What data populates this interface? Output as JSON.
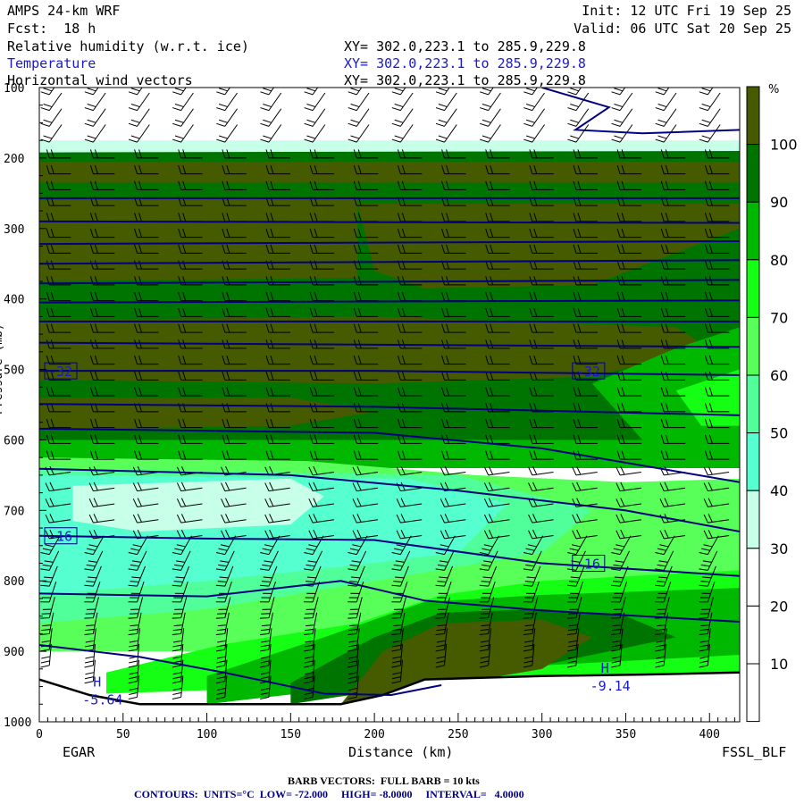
{
  "header": {
    "model": "AMPS 24-km WRF",
    "fcst": "Fcst:  18 h",
    "init": "Init: 12 UTC Fri 19 Sep 25",
    "valid": "Valid: 06 UTC Sat 20 Sep 25",
    "fields": [
      {
        "name": "Relative humidity (w.r.t. ice)",
        "xy": "XY= 302.0,223.1 to 285.9,229.8"
      },
      {
        "name": "Temperature",
        "xy": "XY= 302.0,223.1 to 285.9,229.8"
      },
      {
        "name": "Horizontal wind vectors",
        "xy": "XY= 302.0,223.1 to 285.9,229.8"
      }
    ]
  },
  "footer": {
    "start_station": "EGAR",
    "end_station": "FSSL_BLF",
    "barb_note": "BARB VECTORS:  FULL BARB = 10 kts",
    "contour_note": "CONTOURS:  UNITS=°C  LOW= -72.000     HIGH= -8.0000     INTERVAL=   4.0000"
  },
  "chart_data": {
    "type": "heatmap",
    "title": "Relative humidity (w.r.t. ice), Temperature, Horizontal wind vectors",
    "xlabel": "Distance (km)",
    "ylabel": "Pressure (mb)",
    "xlim": [
      0,
      418
    ],
    "ylim": [
      1000,
      100
    ],
    "xticks": [
      "0",
      "50",
      "100",
      "150",
      "200",
      "250",
      "300",
      "350",
      "400"
    ],
    "yticks": [
      "100",
      "200",
      "300",
      "400",
      "500",
      "600",
      "700",
      "800",
      "900",
      "1000"
    ],
    "colorbar": {
      "unit": "%",
      "labels": [
        "100",
        "90",
        "80",
        "70",
        "60",
        "50",
        "40",
        "30",
        "20",
        "10"
      ],
      "levels": [
        0,
        10,
        20,
        30,
        40,
        50,
        60,
        70,
        80,
        90,
        100
      ],
      "colors": [
        "#ffffff",
        "#ffffff",
        "#ffffff",
        "#c8ffe8",
        "#55ffd0",
        "#50ff9a",
        "#58ff58",
        "#14ff14",
        "#00b800",
        "#007400",
        "#465a00"
      ]
    },
    "rh_regions": [
      {
        "rh": ">100",
        "color": "#465a00",
        "poly": [
          [
            0,
            205
          ],
          [
            418,
            205
          ],
          [
            418,
            235
          ],
          [
            0,
            235
          ]
        ]
      },
      {
        "rh": ">100",
        "color": "#465a00",
        "poly": [
          [
            0,
            260
          ],
          [
            190,
            255
          ],
          [
            190,
            370
          ],
          [
            0,
            375
          ]
        ]
      },
      {
        "rh": ">100",
        "color": "#465a00",
        "poly": [
          [
            190,
            265
          ],
          [
            418,
            265
          ],
          [
            418,
            300
          ],
          [
            330,
            380
          ],
          [
            230,
            385
          ],
          [
            200,
            360
          ]
        ]
      },
      {
        "rh": ">100",
        "color": "#465a00",
        "poly": [
          [
            0,
            430
          ],
          [
            200,
            425
          ],
          [
            380,
            440
          ],
          [
            400,
            470
          ],
          [
            330,
            510
          ],
          [
            200,
            520
          ],
          [
            0,
            515
          ]
        ]
      },
      {
        "rh": ">100",
        "color": "#465a00",
        "poly": [
          [
            0,
            540
          ],
          [
            150,
            540
          ],
          [
            200,
            560
          ],
          [
            150,
            580
          ],
          [
            0,
            585
          ]
        ]
      },
      {
        "rh": "80-90",
        "color": "#00b800",
        "poly": [
          [
            330,
            520
          ],
          [
            380,
            470
          ],
          [
            418,
            440
          ],
          [
            418,
            600
          ],
          [
            360,
            600
          ]
        ]
      },
      {
        "rh": "70-80",
        "color": "#14ff14",
        "poly": [
          [
            380,
            530
          ],
          [
            418,
            500
          ],
          [
            418,
            580
          ],
          [
            395,
            580
          ]
        ]
      },
      {
        "rh": "80-90",
        "color": "#00b800",
        "poly": [
          [
            0,
            600
          ],
          [
            418,
            600
          ],
          [
            418,
            640
          ],
          [
            0,
            640
          ]
        ]
      },
      {
        "rh": "60-70",
        "color": "#58ff58",
        "poly": [
          [
            0,
            625
          ],
          [
            160,
            630
          ],
          [
            260,
            650
          ],
          [
            350,
            660
          ],
          [
            418,
            655
          ],
          [
            418,
            900
          ],
          [
            0,
            900
          ]
        ]
      },
      {
        "rh": "50-60",
        "color": "#50ff9a",
        "poly": [
          [
            0,
            640
          ],
          [
            250,
            650
          ],
          [
            330,
            700
          ],
          [
            300,
            760
          ],
          [
            200,
            800
          ],
          [
            100,
            840
          ],
          [
            0,
            860
          ]
        ]
      },
      {
        "rh": "40-50",
        "color": "#55ffd0",
        "poly": [
          [
            0,
            650
          ],
          [
            220,
            655
          ],
          [
            280,
            690
          ],
          [
            250,
            760
          ],
          [
            180,
            780
          ],
          [
            100,
            800
          ],
          [
            0,
            820
          ]
        ]
      },
      {
        "rh": "30-40",
        "color": "#c8ffe8",
        "poly": [
          [
            20,
            665
          ],
          [
            150,
            655
          ],
          [
            170,
            680
          ],
          [
            150,
            720
          ],
          [
            60,
            730
          ],
          [
            20,
            715
          ]
        ]
      },
      {
        "rh": "70-80",
        "color": "#14ff14",
        "poly": [
          [
            40,
            930
          ],
          [
            110,
            890
          ],
          [
            190,
            860
          ],
          [
            240,
            820
          ],
          [
            300,
            800
          ],
          [
            418,
            785
          ],
          [
            418,
            930
          ],
          [
            40,
            960
          ]
        ]
      },
      {
        "rh": "80-90",
        "color": "#00b800",
        "poly": [
          [
            100,
            935
          ],
          [
            170,
            880
          ],
          [
            230,
            830
          ],
          [
            300,
            820
          ],
          [
            418,
            810
          ],
          [
            418,
            905
          ],
          [
            300,
            920
          ],
          [
            100,
            975
          ]
        ]
      },
      {
        "rh": "90-100",
        "color": "#007400",
        "poly": [
          [
            150,
            945
          ],
          [
            200,
            880
          ],
          [
            240,
            845
          ],
          [
            300,
            840
          ],
          [
            350,
            850
          ],
          [
            380,
            880
          ],
          [
            300,
            920
          ],
          [
            150,
            975
          ]
        ]
      },
      {
        "rh": ">100",
        "color": "#465a00",
        "poly": [
          [
            180,
            975
          ],
          [
            205,
            900
          ],
          [
            240,
            860
          ],
          [
            300,
            855
          ],
          [
            330,
            880
          ],
          [
            300,
            925
          ],
          [
            200,
            965
          ]
        ]
      },
      {
        "rh": "30-40",
        "color": "#c8ffe8",
        "poly": [
          [
            0,
            175
          ],
          [
            418,
            175
          ],
          [
            418,
            190
          ],
          [
            0,
            192
          ]
        ]
      }
    ],
    "terrain": [
      [
        0,
        940
      ],
      [
        30,
        962
      ],
      [
        60,
        975
      ],
      [
        180,
        975
      ],
      [
        205,
        962
      ],
      [
        230,
        940
      ],
      [
        300,
        935
      ],
      [
        360,
        933
      ],
      [
        418,
        930
      ]
    ],
    "temperature_contours": [
      {
        "points": [
          [
            0,
            257
          ],
          [
            418,
            257
          ]
        ]
      },
      {
        "points": [
          [
            0,
            290
          ],
          [
            418,
            292
          ]
        ]
      },
      {
        "points": [
          [
            0,
            322
          ],
          [
            418,
            318
          ]
        ]
      },
      {
        "points": [
          [
            0,
            350
          ],
          [
            418,
            345
          ]
        ]
      },
      {
        "points": [
          [
            0,
            378
          ],
          [
            418,
            373
          ]
        ]
      },
      {
        "points": [
          [
            0,
            405
          ],
          [
            418,
            402
          ]
        ]
      },
      {
        "points": [
          [
            0,
            432
          ],
          [
            418,
            432
          ]
        ]
      },
      {
        "points": [
          [
            0,
            462
          ],
          [
            418,
            468
          ]
        ]
      },
      {
        "points": [
          [
            0,
            502
          ],
          [
            200,
            502
          ],
          [
            418,
            508
          ]
        ],
        "label": "-32",
        "label_at": [
          [
            0,
            502
          ],
          [
            315,
            502
          ]
        ]
      },
      {
        "points": [
          [
            0,
            549
          ],
          [
            200,
            553
          ],
          [
            418,
            565
          ]
        ]
      },
      {
        "points": [
          [
            0,
            584
          ],
          [
            200,
            590
          ],
          [
            300,
            612
          ],
          [
            418,
            660
          ]
        ]
      },
      {
        "points": [
          [
            0,
            641
          ],
          [
            150,
            650
          ],
          [
            250,
            672
          ],
          [
            350,
            700
          ],
          [
            418,
            730
          ]
        ]
      },
      {
        "points": [
          [
            0,
            736
          ],
          [
            100,
            740
          ],
          [
            200,
            742
          ],
          [
            300,
            775
          ],
          [
            418,
            793
          ]
        ],
        "label": "-16",
        "label_at": [
          [
            0,
            736
          ],
          [
            315,
            775
          ]
        ]
      },
      {
        "points": [
          [
            0,
            818
          ],
          [
            100,
            822
          ],
          [
            180,
            800
          ],
          [
            230,
            828
          ],
          [
            300,
            842
          ],
          [
            418,
            858
          ]
        ]
      },
      {
        "points": [
          [
            0,
            891
          ],
          [
            60,
            908
          ],
          [
            110,
            930
          ],
          [
            170,
            960
          ],
          [
            210,
            962
          ],
          [
            240,
            948
          ]
        ]
      },
      {
        "points": [
          [
            300,
            100
          ],
          [
            340,
            128
          ],
          [
            320,
            160
          ],
          [
            360,
            165
          ],
          [
            418,
            160
          ]
        ]
      }
    ],
    "highs": [
      {
        "label": "H",
        "value": "-5.64",
        "at": [
          30,
          950
        ]
      },
      {
        "label": "H",
        "value": "-9.14",
        "at": [
          333,
          930
        ]
      }
    ]
  }
}
